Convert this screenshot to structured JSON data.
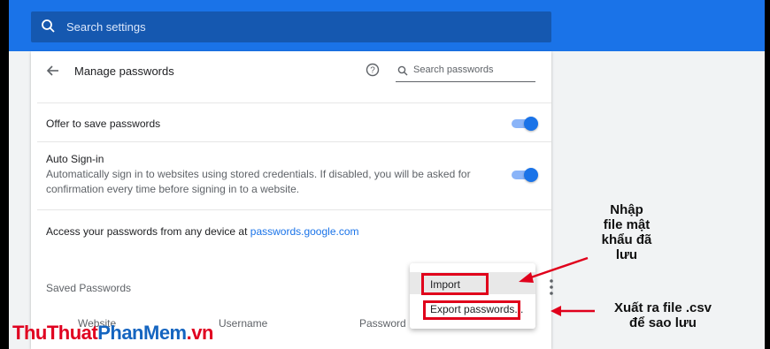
{
  "search": {
    "placeholder": "Search settings"
  },
  "header": {
    "title": "Manage passwords",
    "search_placeholder": "Search passwords"
  },
  "offer": {
    "label": "Offer to save passwords",
    "enabled": true
  },
  "autosignin": {
    "title": "Auto Sign-in",
    "desc_line1": "Automatically sign in to websites using stored credentials. If disabled, you will be asked for",
    "desc_line2": "confirmation every time before signing in to a website.",
    "enabled": true
  },
  "access": {
    "prefix": "Access your passwords from any device at ",
    "link": "passwords.google.com"
  },
  "saved": {
    "title": "Saved Passwords",
    "columns": [
      "Website",
      "Username",
      "Password"
    ]
  },
  "menu": {
    "items": [
      "Import",
      "Export passwords..."
    ]
  },
  "annotations": {
    "import_note": [
      "Nhập",
      "file mật",
      "khẩu đã",
      "lưu"
    ],
    "export_note": [
      "Xuất ra file .csv",
      "để sao lưu"
    ]
  },
  "watermark": {
    "part1": "ThuThuat",
    "part2": "PhanMem",
    "part3": ".vn"
  },
  "colors": {
    "accent": "#1a73e8",
    "annotation": "#e0001b"
  }
}
